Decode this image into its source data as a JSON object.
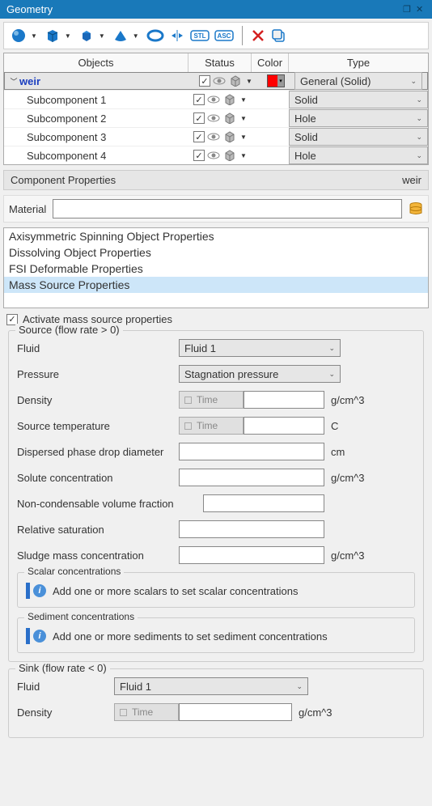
{
  "title": "Geometry",
  "headers": {
    "objects": "Objects",
    "status": "Status",
    "color": "Color",
    "type": "Type"
  },
  "rows": [
    {
      "name": "weir",
      "type": "General (Solid)",
      "main": true,
      "color": "red"
    },
    {
      "name": "Subcomponent 1",
      "type": "Solid"
    },
    {
      "name": "Subcomponent 2",
      "type": "Hole"
    },
    {
      "name": "Subcomponent 3",
      "type": "Solid"
    },
    {
      "name": "Subcomponent 4",
      "type": "Hole"
    }
  ],
  "comp": {
    "label": "Component Properties",
    "name": "weir"
  },
  "material_label": "Material",
  "proplist": [
    "Axisymmetric Spinning Object Properties",
    "Dissolving Object Properties",
    "FSI Deformable Properties",
    "Mass Source Properties"
  ],
  "activate": "Activate mass source properties",
  "time_label": "Time",
  "source": {
    "title": "Source (flow rate > 0)",
    "fluid_label": "Fluid",
    "fluid_val": "Fluid 1",
    "pressure_label": "Pressure",
    "pressure_val": "Stagnation pressure",
    "density_label": "Density",
    "density_unit": "g/cm^3",
    "temp_label": "Source temperature",
    "temp_unit": "C",
    "drop_label": "Dispersed phase drop diameter",
    "drop_unit": "cm",
    "solute_label": "Solute concentration",
    "solute_unit": "g/cm^3",
    "ncvf_label": "Non-condensable volume fraction",
    "relsat_label": "Relative saturation",
    "sludge_label": "Sludge mass concentration",
    "sludge_unit": "g/cm^3",
    "scalar_title": "Scalar concentrations",
    "scalar_msg": "Add one or more scalars to set scalar concentrations",
    "sediment_title": "Sediment concentrations",
    "sediment_msg": "Add one or more sediments to set sediment concentrations"
  },
  "sink": {
    "title": "Sink (flow rate < 0)",
    "fluid_label": "Fluid",
    "fluid_val": "Fluid 1",
    "density_label": "Density",
    "density_unit": "g/cm^3"
  }
}
